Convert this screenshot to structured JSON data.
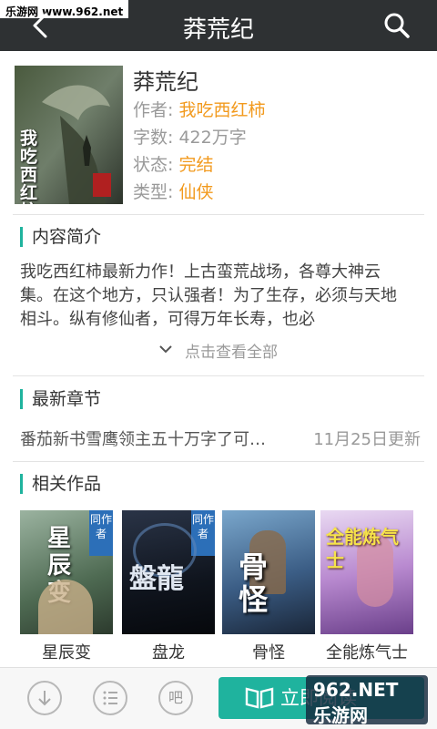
{
  "watermark_top": "乐游网 www.962.net",
  "header": {
    "title": "莽荒纪"
  },
  "book": {
    "name": "莽荒纪",
    "author_label": "作者:",
    "author": "我吃西红柿",
    "words_label": "字数:",
    "words": "422万字",
    "status_label": "状态:",
    "status": "完结",
    "type_label": "类型:",
    "type": "仙侠",
    "cover_text": "我吃西红柿"
  },
  "intro": {
    "section_title": "内容简介",
    "text": "我吃西红柿最新力作！上古蛮荒战场，各尊大神云集。在这个地方，只认强者！为了生存，必须与天地相斗。纵有修仙者，可得万年长寿，也必",
    "more_label": "点击查看全部"
  },
  "latest": {
    "section_title": "最新章节",
    "chapter": "番茄新书雪鹰领主五十万字了可…",
    "date": "11月25日更新"
  },
  "related": {
    "section_title": "相关作品",
    "items": [
      {
        "name": "星辰变",
        "badge": "同作者",
        "cover_title": "星辰变"
      },
      {
        "name": "盘龙",
        "badge": "同作者",
        "cover_title": "盤龍"
      },
      {
        "name": "骨怪",
        "cover_title": "骨怪"
      },
      {
        "name": "全能炼气士",
        "cover_title": "全能炼气士"
      }
    ]
  },
  "bottom": {
    "bar_icon_label": "吧",
    "read_label": "立即阅读"
  },
  "watermark_bottom": "962.NET 乐游网",
  "colors": {
    "accent": "#1fb39e",
    "orange": "#f29a1e",
    "titlebar": "#2e3133"
  }
}
